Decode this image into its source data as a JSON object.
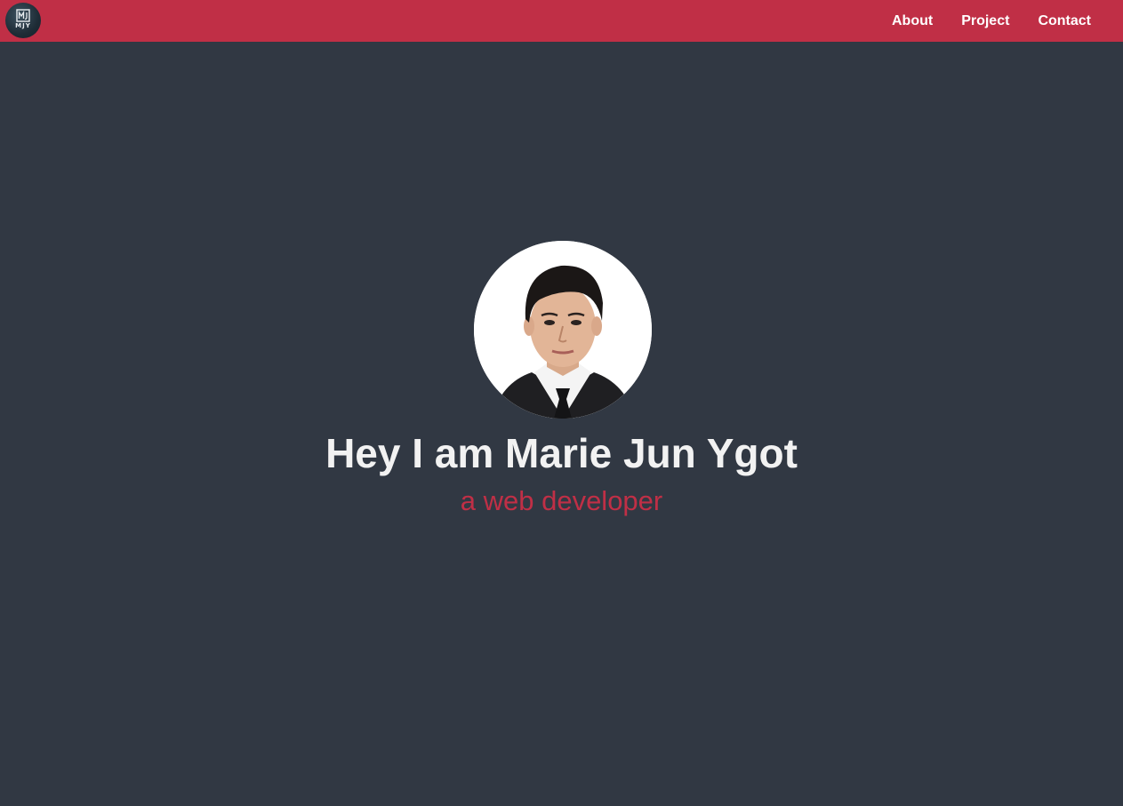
{
  "nav": {
    "logo_text": "MJY",
    "logo_icon": "mj-monogram-icon",
    "links": [
      {
        "label": "About"
      },
      {
        "label": "Project"
      },
      {
        "label": "Contact"
      }
    ]
  },
  "hero": {
    "headline": "Hey I am Marie Jun Ygot",
    "subline": "a web developer",
    "avatar": "profile-photo"
  },
  "colors": {
    "accent": "#c02f46",
    "background": "#313843",
    "headline": "#f2f2f2"
  }
}
